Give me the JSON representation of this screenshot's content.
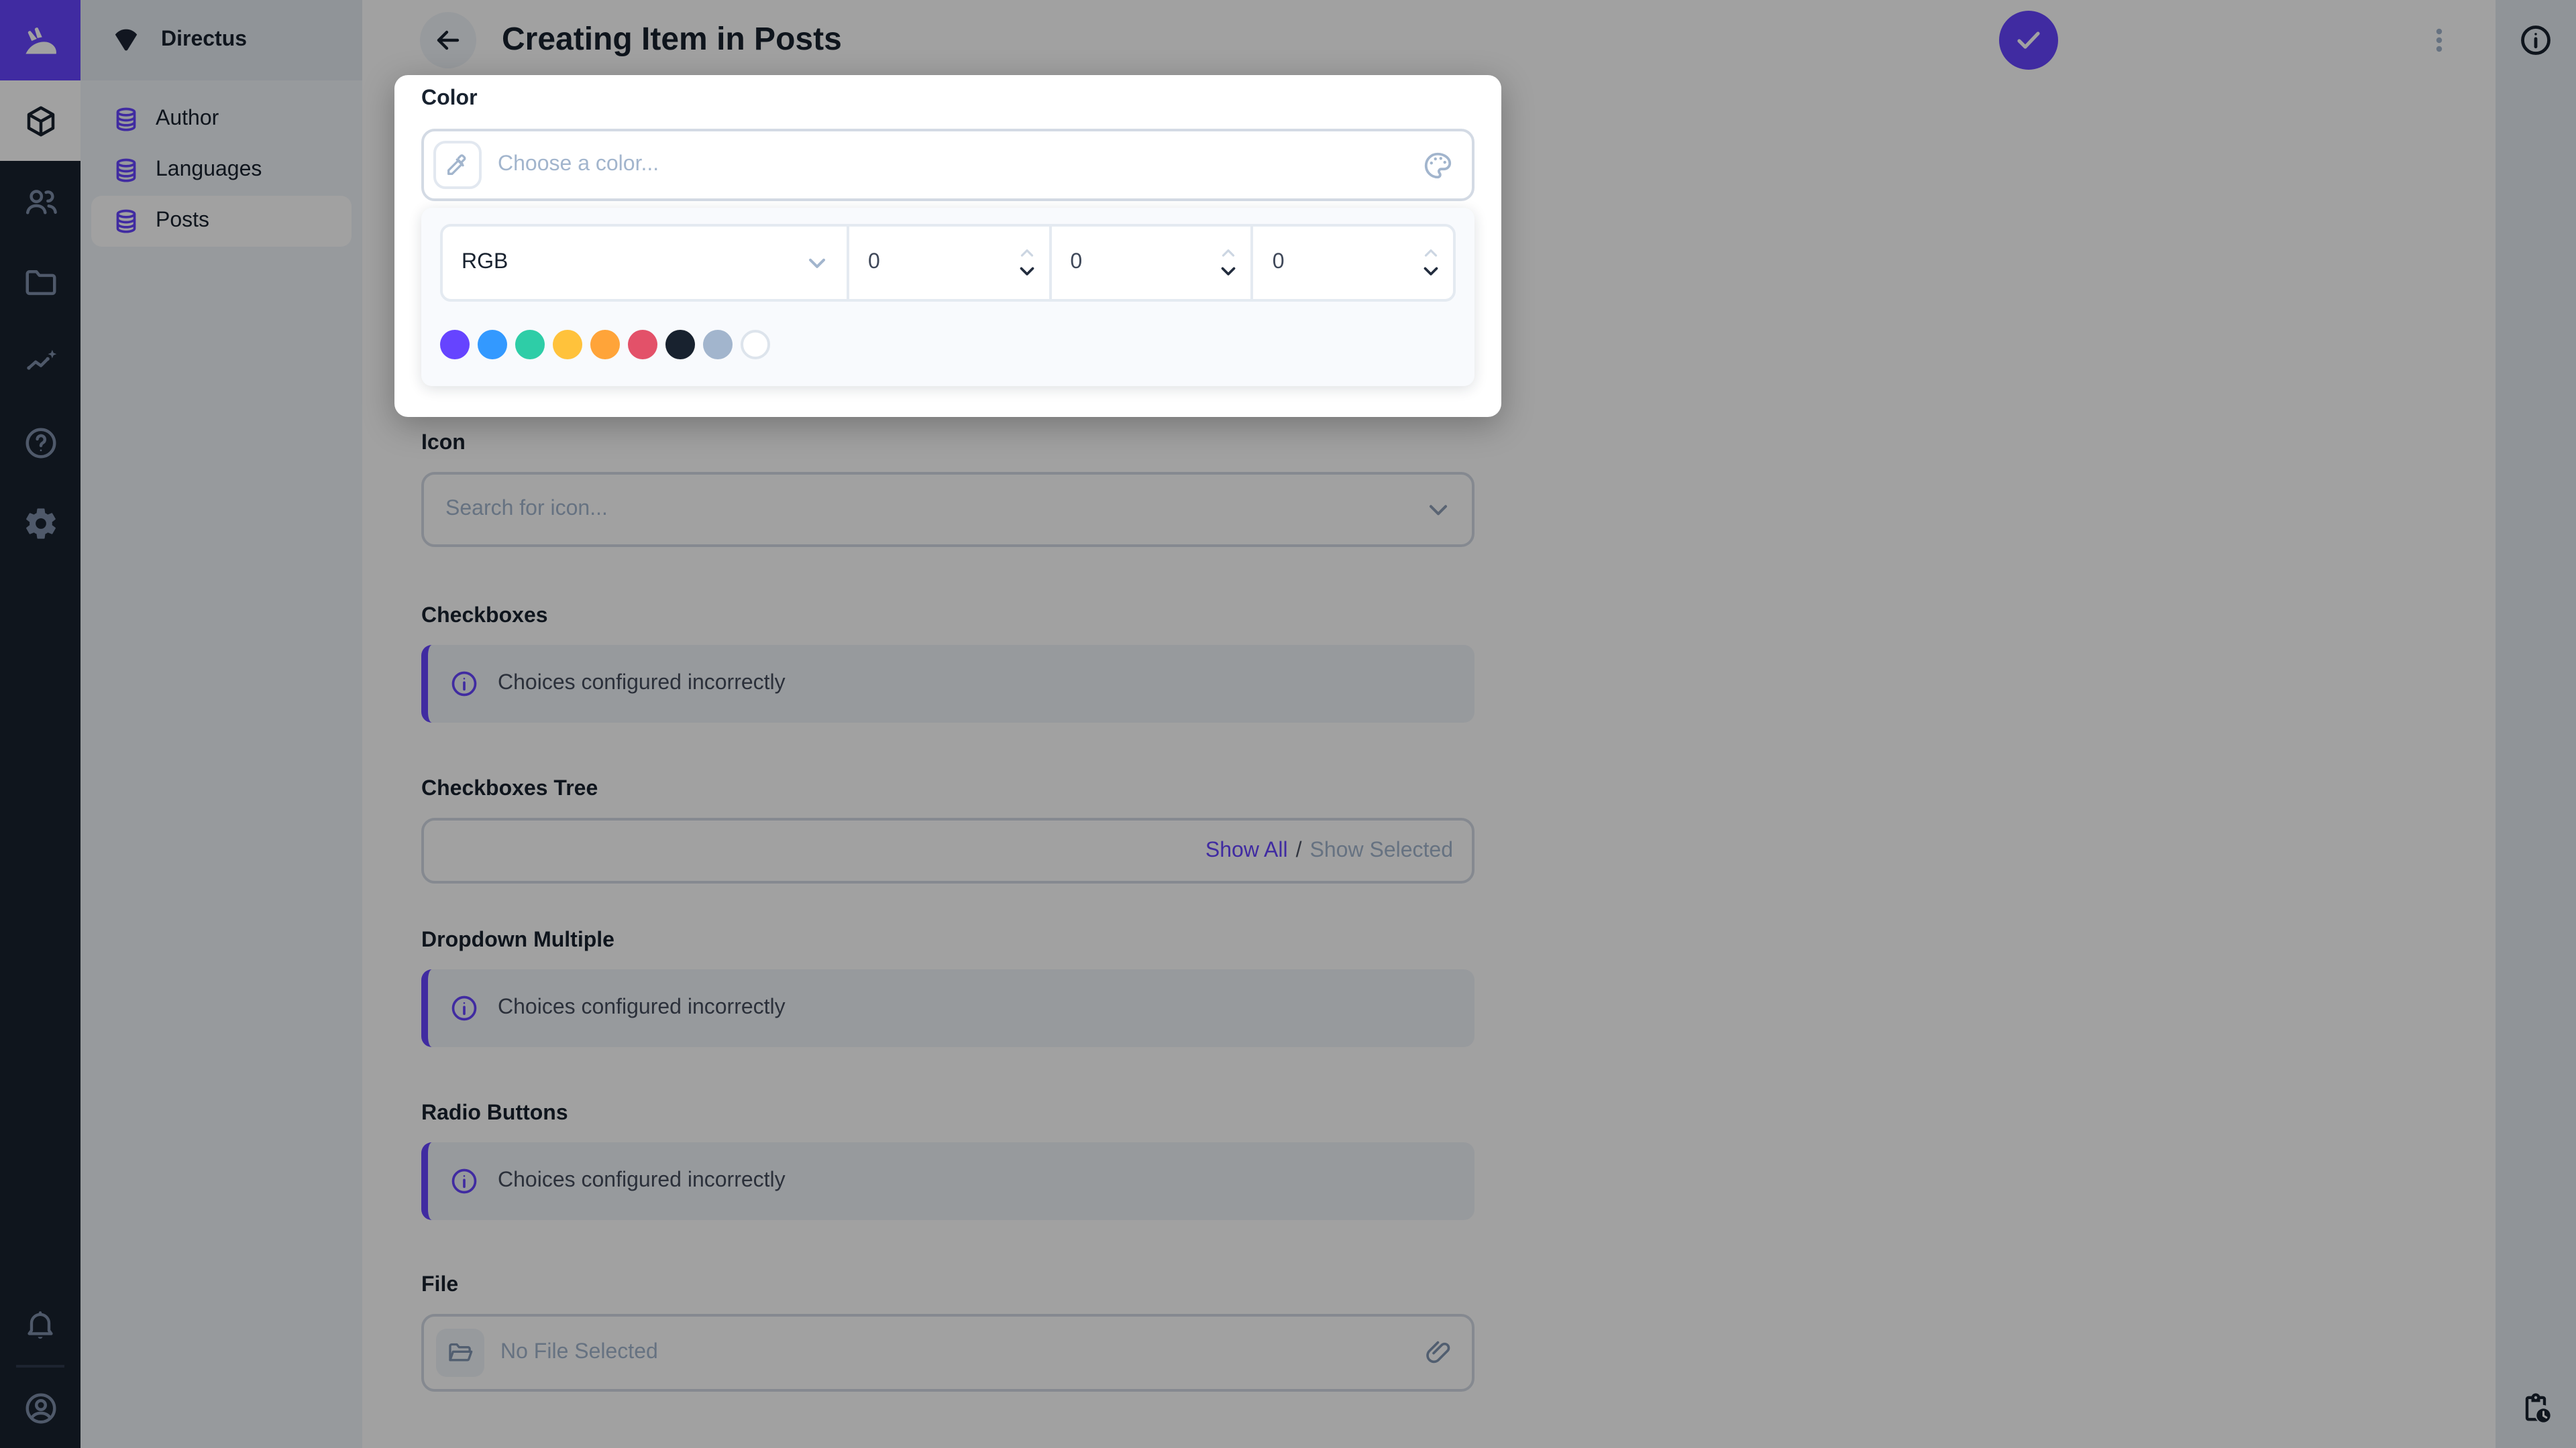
{
  "app": {
    "accent_color": "#6644ff",
    "module_bar_color": "#18222f",
    "modules": [
      {
        "name": "content",
        "icon": "box-icon",
        "active": true
      },
      {
        "name": "user-directory",
        "icon": "people-icon",
        "active": false
      },
      {
        "name": "file-library",
        "icon": "folder-icon",
        "active": false
      },
      {
        "name": "insights",
        "icon": "insights-icon",
        "active": false
      },
      {
        "name": "documentation",
        "icon": "help-icon",
        "active": false
      },
      {
        "name": "settings",
        "icon": "gear-icon",
        "active": false
      }
    ],
    "module_bottom": [
      {
        "name": "notifications",
        "icon": "bell-icon"
      },
      {
        "name": "account",
        "icon": "account-circle-icon"
      }
    ]
  },
  "sidebar": {
    "project_name": "Directus",
    "project_icon": "project-shield-icon",
    "items": [
      {
        "label": "Author",
        "icon": "database-icon",
        "active": false
      },
      {
        "label": "Languages",
        "icon": "database-icon",
        "active": false
      },
      {
        "label": "Posts",
        "icon": "database-icon",
        "active": true
      }
    ]
  },
  "header": {
    "title": "Creating Item in Posts",
    "back_icon": "arrow-left-icon",
    "save_icon": "check-icon",
    "menu_icon": "kebab-icon"
  },
  "right_sidebar": {
    "top_icon": "info-icon",
    "bottom_icon": "pending-actions-icon"
  },
  "color_picker": {
    "label": "Color",
    "input_placeholder": "Choose a color...",
    "eyedropper_icon": "eyedropper-icon",
    "palette_icon": "palette-icon",
    "mode": "RGB",
    "channels": [
      "0",
      "0",
      "0"
    ],
    "swatches": [
      "#6644ff",
      "#3399ff",
      "#2ecda7",
      "#ffc23b",
      "#ffa439",
      "#e35169",
      "#18222f",
      "#a2b5cd",
      "#ffffff"
    ]
  },
  "fields": {
    "icon": {
      "label": "Icon",
      "placeholder": "Search for icon..."
    },
    "checkboxes": {
      "label": "Checkboxes",
      "notice": "Choices configured incorrectly"
    },
    "checkboxes_tree": {
      "label": "Checkboxes Tree",
      "show_all": "Show All",
      "separator": "/",
      "show_selected": "Show Selected"
    },
    "dropdown_multiple": {
      "label": "Dropdown Multiple",
      "notice": "Choices configured incorrectly"
    },
    "radio_buttons": {
      "label": "Radio Buttons",
      "notice": "Choices configured incorrectly"
    },
    "file": {
      "label": "File",
      "placeholder": "No File Selected"
    }
  }
}
